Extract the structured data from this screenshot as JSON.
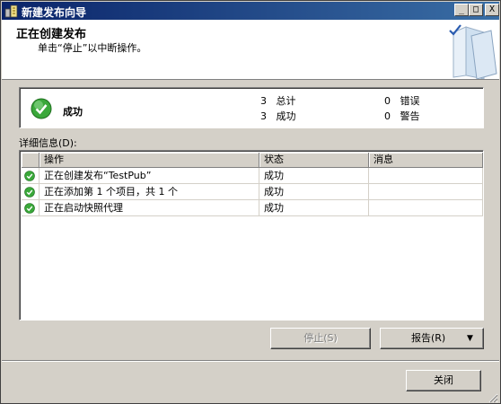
{
  "window": {
    "title": "新建发布向导",
    "min": "_",
    "max": "□",
    "close": "X"
  },
  "header": {
    "title": "正在创建发布",
    "subtitle": "单击“停止”以中断操作。",
    "art_icon": "books-checkmark-icon"
  },
  "summary": {
    "status": "成功",
    "status_icon": "success-check-icon",
    "total_count": "3",
    "total_label": "总计",
    "success_count": "3",
    "success_label": "成功",
    "error_count": "0",
    "error_label": "错误",
    "warning_count": "0",
    "warning_label": "警告"
  },
  "details_label": "详细信息(D):",
  "grid": {
    "columns": [
      "",
      "操作",
      "状态",
      "消息"
    ],
    "rows": [
      {
        "action": "正在创建发布“TestPub”",
        "status": "成功",
        "message": ""
      },
      {
        "action": "正在添加第 1 个项目，共 1 个",
        "status": "成功",
        "message": ""
      },
      {
        "action": "正在启动快照代理",
        "status": "成功",
        "message": ""
      }
    ]
  },
  "buttons": {
    "stop": "停止(S)",
    "report": "报告(R)",
    "report_arrow": "▼",
    "close": "关闭"
  },
  "colors": {
    "titlebar": "#0a246a",
    "success": "#2e9b2e",
    "face": "#d4d0c8"
  }
}
